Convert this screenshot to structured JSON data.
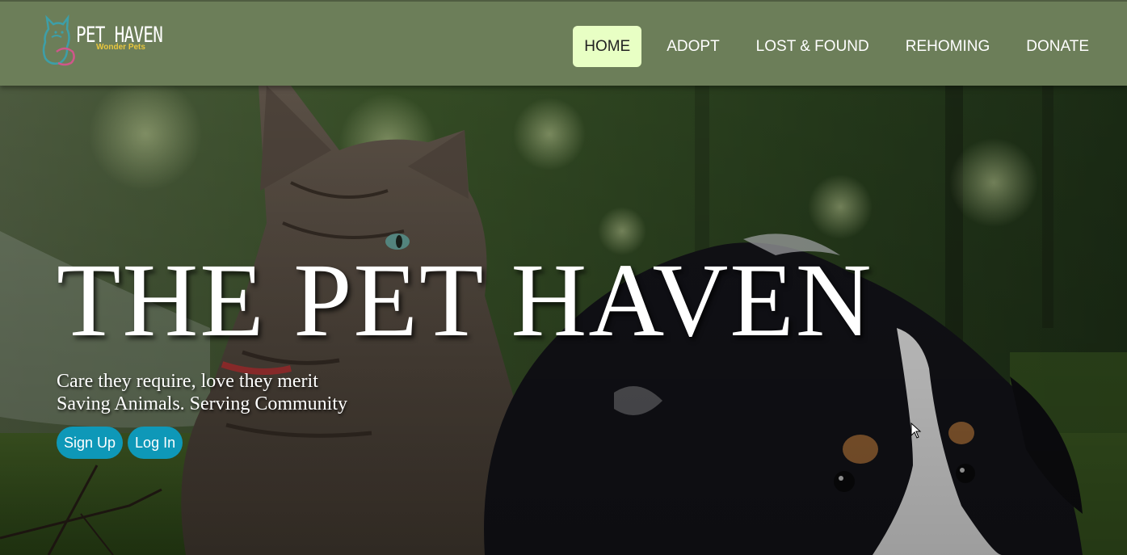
{
  "brand": {
    "name": "PET HAVEN",
    "subtitle": "Wonder Pets",
    "icon": "cat-dog-logo-icon"
  },
  "nav": {
    "items": [
      {
        "label": "HOME",
        "active": true
      },
      {
        "label": "ADOPT",
        "active": false
      },
      {
        "label": "LOST & FOUND",
        "active": false
      },
      {
        "label": "REHOMING",
        "active": false
      },
      {
        "label": "DONATE",
        "active": false
      }
    ]
  },
  "hero": {
    "title": "THE PET HAVEN",
    "tagline_1": "Care they require, love they merit",
    "tagline_2": "Saving Animals. Serving Community",
    "signup_label": "Sign Up",
    "login_label": "Log In",
    "image": "cat-and-puppy-photo"
  },
  "colors": {
    "header_bg": "#6c7e59",
    "nav_active_bg": "#e8ffc4",
    "button_bg": "#0e98b8",
    "logo_accent": "#e8c63e"
  }
}
